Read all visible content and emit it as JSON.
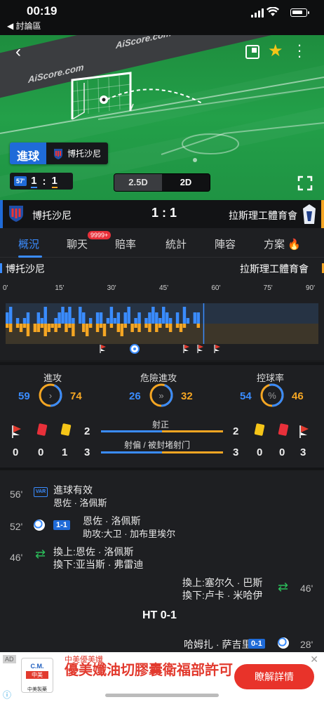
{
  "status_bar": {
    "time": "00:19",
    "back_app": "◀ 討論區"
  },
  "pitch": {
    "watermark": "AiScore.com",
    "goal_tag": "進球",
    "goal_team": "博托沙尼",
    "minute_badge": "57'",
    "score_home": "1",
    "score_sep": ":",
    "score_away": "1",
    "view_modes": [
      "2.5D",
      "2D"
    ],
    "active_view": "2D"
  },
  "match": {
    "home": "博托沙尼",
    "away": "拉斯理工體育會",
    "score": "1 : 1"
  },
  "tabs": [
    {
      "label": "概況",
      "active": true
    },
    {
      "label": "聊天",
      "badge": "9999+"
    },
    {
      "label": "賠率"
    },
    {
      "label": "統計"
    },
    {
      "label": "陣容"
    },
    {
      "label": "方案"
    }
  ],
  "timeline": {
    "home": "博托沙尼",
    "away": "拉斯理工體育會",
    "ticks": [
      "0'",
      "15'",
      "30'",
      "45'",
      "60'",
      "75'",
      "90'"
    ],
    "current_minute": 57,
    "home_pressure": [
      2,
      3,
      0,
      1,
      0,
      1,
      2,
      0,
      0,
      2,
      1,
      3,
      0,
      0,
      1,
      2,
      3,
      2,
      3,
      1,
      0,
      3,
      2,
      0,
      1,
      0,
      2,
      2,
      0,
      1,
      3,
      1,
      2,
      0,
      2,
      3,
      0,
      1,
      2,
      0,
      1,
      2,
      3,
      2,
      1,
      3,
      2,
      1,
      0,
      2,
      0,
      3,
      1,
      0,
      2,
      2,
      0,
      0,
      0,
      0,
      0,
      0,
      0,
      0,
      0,
      0,
      0,
      0,
      0,
      0,
      0,
      0,
      0,
      0,
      0,
      0,
      0,
      0,
      0,
      0,
      0,
      0,
      0,
      0,
      0,
      0,
      0,
      0,
      0,
      0
    ],
    "away_pressure": [
      1,
      2,
      0,
      1,
      2,
      1,
      3,
      0,
      2,
      2,
      1,
      3,
      2,
      1,
      2,
      1,
      0,
      2,
      1,
      3,
      0,
      0,
      2,
      3,
      1,
      0,
      2,
      1,
      3,
      0,
      1,
      0,
      2,
      3,
      1,
      0,
      2,
      1,
      2,
      0,
      1,
      2,
      0,
      2,
      1,
      0,
      1,
      2,
      0,
      1,
      2,
      1,
      0,
      0,
      0,
      1,
      0,
      0,
      0,
      0,
      0,
      0,
      0,
      0,
      0,
      0,
      0,
      0,
      0,
      0,
      0,
      0,
      0,
      0,
      0,
      0,
      0,
      0,
      0,
      0,
      0,
      0,
      0,
      0,
      0,
      0,
      0,
      0,
      0,
      0
    ],
    "events": [
      {
        "minute": 28,
        "icon": "corner-flag-icon"
      },
      {
        "minute": 37,
        "icon": "ball-icon"
      },
      {
        "minute": 52,
        "icon": "corner-flag-icon"
      },
      {
        "minute": 56,
        "icon": "corner-flag-icon"
      },
      {
        "minute": 61,
        "icon": "corner-flag-icon"
      }
    ]
  },
  "stats": {
    "attack": {
      "label": "進攻",
      "home": "59",
      "away": "74",
      "home_share": 0.44
    },
    "danger": {
      "label": "危險進攻",
      "home": "26",
      "away": "32",
      "home_share": 0.45
    },
    "possession": {
      "label": "控球率",
      "home": "54",
      "away": "46",
      "home_share": 0.54,
      "symbol": "%"
    },
    "shots_on": {
      "label": "射正",
      "home": "2",
      "away": "2",
      "home_share": 0.5
    },
    "shots_off": {
      "label": "射偏 / 被封堵射门",
      "home": "3",
      "away": "3",
      "home_share": 0.5
    },
    "home_cards": {
      "corners": "0",
      "red": "0",
      "yellow": "1"
    },
    "away_cards": {
      "corners": "3",
      "red": "0",
      "yellow": "0"
    }
  },
  "events": [
    {
      "minute": "56'",
      "title": "進球有效",
      "sub": "恩佐 · 洛佩斯",
      "icon": "var-icon"
    },
    {
      "minute": "52'",
      "score": "1-1",
      "title": "恩佐 · 洛佩斯",
      "sub": "助攻:大卫 · 加布里埃尔",
      "icon": "ball-icon"
    },
    {
      "minute": "46'",
      "title": "換上:恩佐 · 洛佩斯",
      "sub": "換下:亚当斯 · 弗雷迪",
      "icon": "substitution-icon"
    },
    {
      "minute": "46'",
      "title": "換上:塞尔久 · 巴斯",
      "sub": "換下:卢卡 · 米哈伊",
      "icon": "substitution-icon"
    },
    {
      "half": "HT 0-1"
    },
    {
      "minute": "28'",
      "score": "0-1",
      "title": "哈姆扎 · 萨吉里",
      "icon": "ball-icon"
    }
  ],
  "ad": {
    "tag": "AD",
    "brand": "中美優美孅",
    "headline": "優美孅油切膠囊衛福部許可",
    "cta": "瞭解詳情",
    "logo_top": "C.M.",
    "logo_mid": "中美",
    "logo_bottom": "中美製藥"
  },
  "colors": {
    "home": "#3a8cff",
    "away": "#f5a623",
    "accent": "#1f6bd8"
  }
}
